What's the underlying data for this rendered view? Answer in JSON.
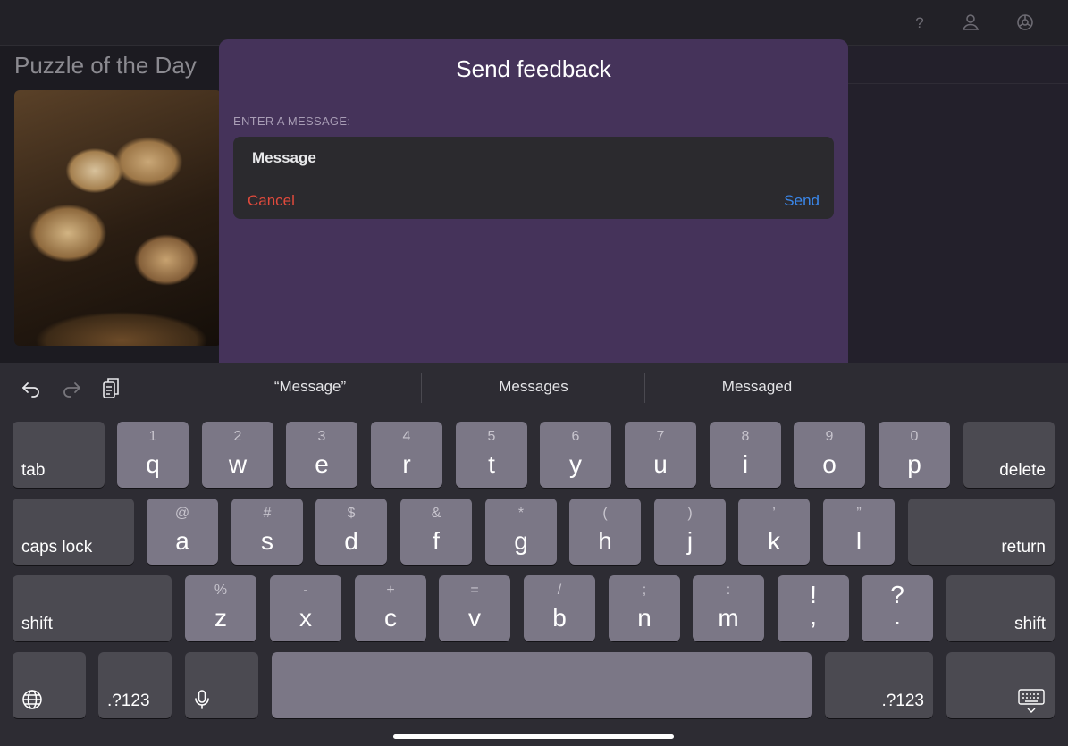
{
  "background": {
    "page_title": "Puzzle of the Day",
    "top_icons": [
      "help-icon",
      "profile-icon",
      "settings-icon"
    ]
  },
  "modal": {
    "title": "Send feedback",
    "section_label": "ENTER A MESSAGE:",
    "message_placeholder": "Message",
    "cancel_label": "Cancel",
    "send_label": "Send",
    "background_color": "#45335a",
    "cancel_color": "#e04a3c",
    "send_color": "#3a86e8"
  },
  "keyboard": {
    "toolbar_icons": [
      "undo-icon",
      "redo-icon",
      "clipboard-icon"
    ],
    "suggestions": [
      "“Message”",
      "Messages",
      "Messaged"
    ],
    "row1": [
      {
        "pri": "q",
        "sec": "1"
      },
      {
        "pri": "w",
        "sec": "2"
      },
      {
        "pri": "e",
        "sec": "3"
      },
      {
        "pri": "r",
        "sec": "4"
      },
      {
        "pri": "t",
        "sec": "5"
      },
      {
        "pri": "y",
        "sec": "6"
      },
      {
        "pri": "u",
        "sec": "7"
      },
      {
        "pri": "i",
        "sec": "8"
      },
      {
        "pri": "o",
        "sec": "9"
      },
      {
        "pri": "p",
        "sec": "0"
      }
    ],
    "row2": [
      {
        "pri": "a",
        "sec": "@"
      },
      {
        "pri": "s",
        "sec": "#"
      },
      {
        "pri": "d",
        "sec": "$"
      },
      {
        "pri": "f",
        "sec": "&"
      },
      {
        "pri": "g",
        "sec": "*"
      },
      {
        "pri": "h",
        "sec": "("
      },
      {
        "pri": "j",
        "sec": ")"
      },
      {
        "pri": "k",
        "sec": "’"
      },
      {
        "pri": "l",
        "sec": "”"
      }
    ],
    "row3": [
      {
        "pri": "z",
        "sec": "%"
      },
      {
        "pri": "x",
        "sec": "-"
      },
      {
        "pri": "c",
        "sec": "+"
      },
      {
        "pri": "v",
        "sec": "="
      },
      {
        "pri": "b",
        "sec": "/"
      },
      {
        "pri": "n",
        "sec": ";"
      },
      {
        "pri": "m",
        "sec": ":"
      },
      {
        "pri": ",",
        "sec": "!"
      },
      {
        "pri": ".",
        "sec": "?"
      }
    ],
    "tab_label": "tab",
    "delete_label": "delete",
    "caps_label": "caps lock",
    "return_label": "return",
    "shift_label": "shift",
    "numbers_label": ".?123",
    "icons": [
      "globe-icon",
      "microphone-icon",
      "keyboard-dismiss-icon"
    ]
  }
}
